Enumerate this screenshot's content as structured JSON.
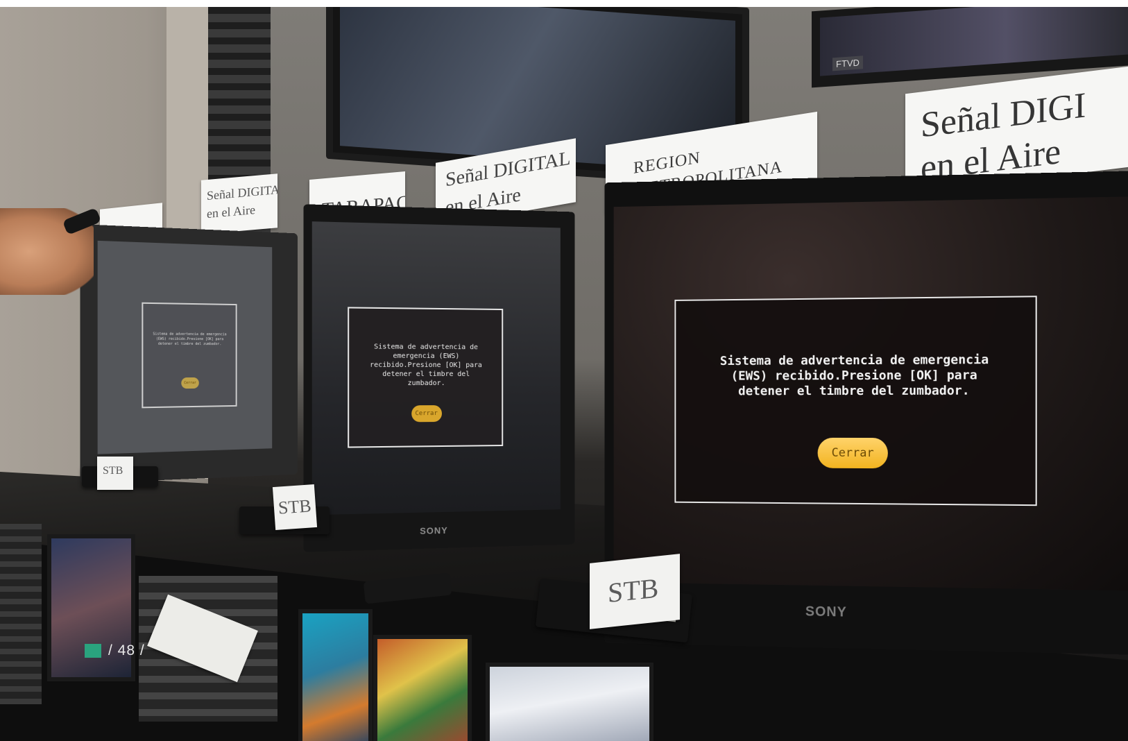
{
  "signs": {
    "card1": "",
    "card2_line1": "Señal DIGITAL",
    "card2_line2": "en el Aire",
    "card3": "TARAPACA",
    "card4_line1": "Señal DIGITAL",
    "card4_line2": "en el Aire",
    "card5_line1": "REGION",
    "card5_line2": "METROPOLITANA",
    "card6_line1": "Señal DIGI",
    "card6_line2": "en el Aire",
    "stb": "STB",
    "top_tv_logo": "FTVD"
  },
  "monitors": {
    "brand": "SONY",
    "ews_message": "Sistema de advertencia de emergencia (EWS) recibido.Presione [OK] para detener el timbre del zumbador.",
    "close_button": "Cerrar"
  },
  "colors": {
    "accent_square": "#2aa37e",
    "button_yellow": "#f2b320"
  },
  "footer": {
    "page_number": "/ 48 /"
  }
}
